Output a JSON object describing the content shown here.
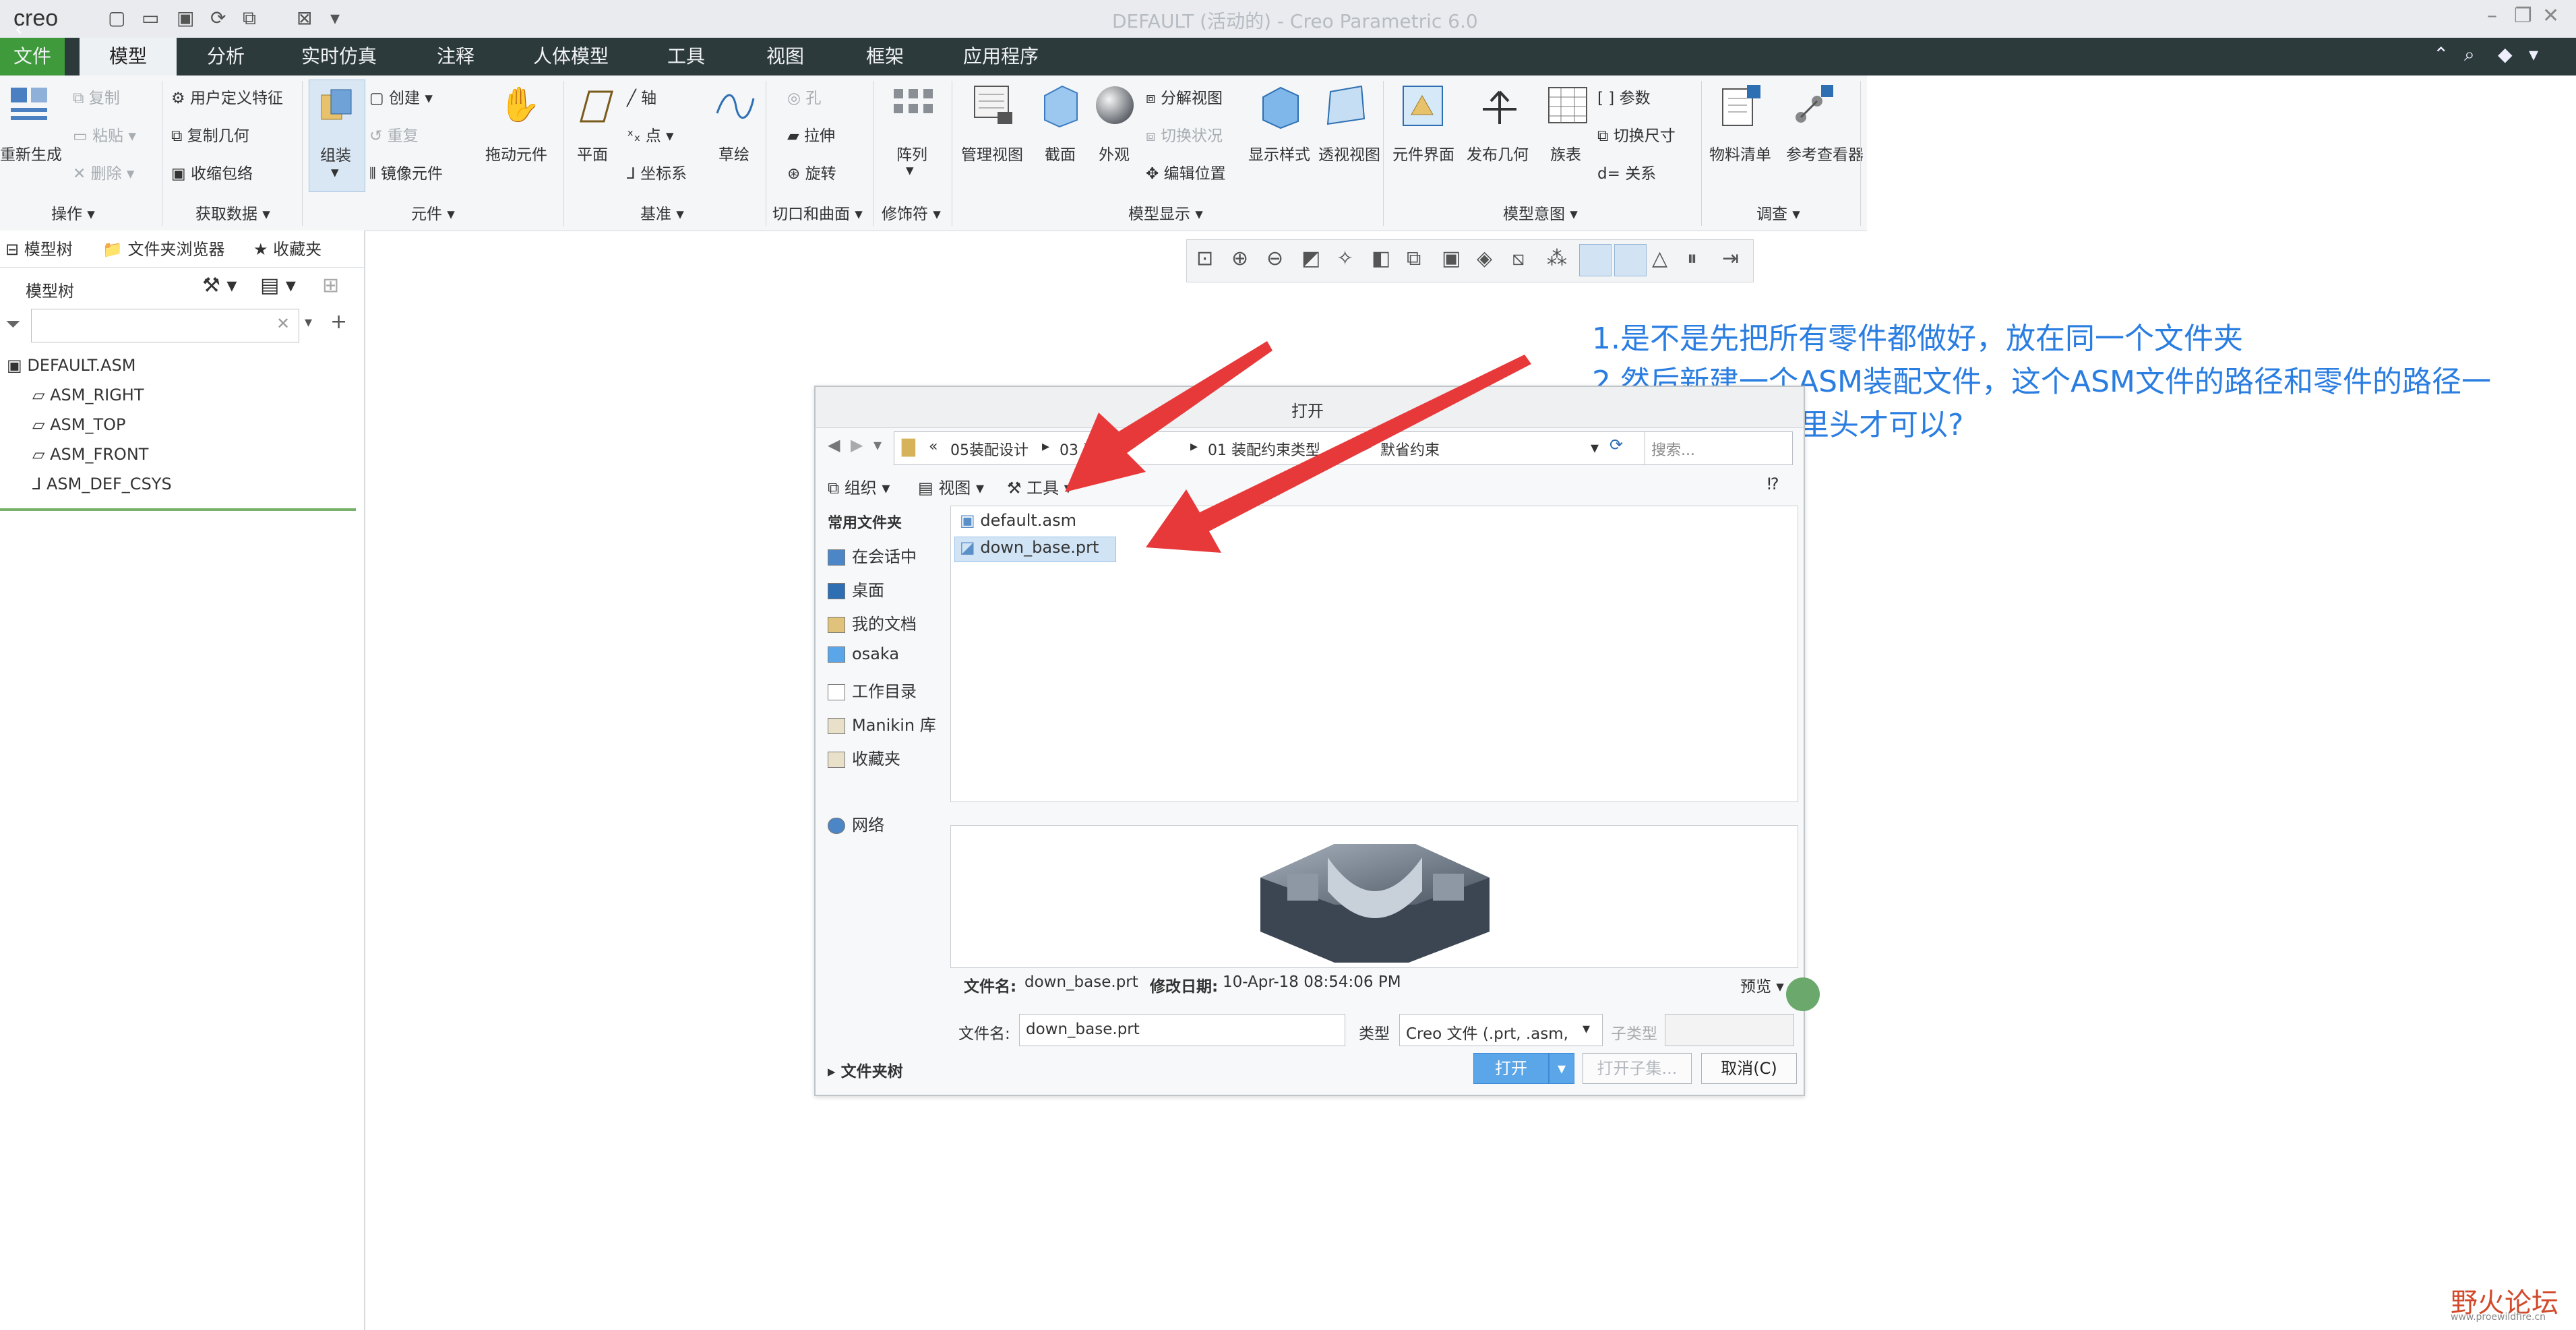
{
  "app": {
    "title": "DEFAULT (活动的) - Creo Parametric 6.0",
    "logo": "creo"
  },
  "ribbon_tabs": [
    "文件",
    "模型",
    "分析",
    "实时仿真",
    "注释",
    "人体模型",
    "工具",
    "视图",
    "框架",
    "应用程序"
  ],
  "ribbon": {
    "regen_label": "重新生成",
    "copy": "复制",
    "paste": "粘贴",
    "delete": "删除",
    "user_feature": "用户定义特征",
    "copy_geometry": "复制几何",
    "shrinkwrap": "收缩包络",
    "assemble": "组装",
    "create": "创建",
    "repeat": "重复",
    "mirror_component": "镜像元件",
    "drag_component": "拖动元件",
    "plane": "平面",
    "axis": "轴",
    "point": "点",
    "csys": "坐标系",
    "sketch": "草绘",
    "hole": "孔",
    "extrude": "拉伸",
    "revolve": "旋转",
    "pattern": "阵列",
    "manage_views": "管理视图",
    "section": "截面",
    "appearance": "外观",
    "explode_view": "分解视图",
    "toggle_status": "切换状况",
    "edit_position": "编辑位置",
    "display_style": "显示样式",
    "perspective_view": "透视视图",
    "component_interface": "元件界面",
    "publish_geometry": "发布几何",
    "family_table": "族表",
    "parameters": "参数",
    "switch_dimensions": "切换尺寸",
    "relations": "关系",
    "bom": "物料清单",
    "reference_viewer": "参考查看器",
    "groups": [
      "操作",
      "获取数据",
      "元件",
      "基准",
      "切口和曲面",
      "修饰符",
      "模型显示",
      "模型意图",
      "调查"
    ]
  },
  "left_panel": {
    "tabs": [
      "模型树",
      "文件夹浏览器",
      "收藏夹"
    ],
    "tree_header": "模型树",
    "tree_items": [
      "DEFAULT.ASM",
      "ASM_RIGHT",
      "ASM_TOP",
      "ASM_FRONT",
      "ASM_DEF_CSYS"
    ]
  },
  "annotation": {
    "line1": "1.是不是先把所有零件都做好，放在同一个文件夹",
    "line2": "2.然后新建一个ASM装配文件，这个ASM文件的路径和零件的路径一",
    "line3": "在同一个文件夹里头才可以?"
  },
  "dialog": {
    "title": "打开",
    "path": [
      "«",
      "05装配设计",
      "03 装",
      "01 装配约束类型",
      "默省约束"
    ],
    "search_placeholder": "搜索...",
    "toolbar": [
      "组织",
      "视图",
      "工具"
    ],
    "sidebar_header": "常用文件夹",
    "sidebar_items": [
      "在会话中",
      "桌面",
      "我的文档",
      "osaka",
      "工作目录",
      "Manikin 库",
      "收藏夹"
    ],
    "network": "网络",
    "files": [
      "default.asm",
      "down_base.prt"
    ],
    "selected_file": "down_base.prt",
    "info_label_name": "文件名:",
    "info_name": "down_base.prt",
    "info_label_date": "修改日期:",
    "info_date": "10-Apr-18 08:54:06 PM",
    "preview_label": "预览",
    "filename_label": "文件名:",
    "filename_value": "down_base.prt",
    "type_label": "类型",
    "type_value": "Creo 文件 (.prt, .asm,",
    "subtype_label": "子类型",
    "folder_tree_label": "文件夹树",
    "open_button": "打开",
    "open_subtype_button": "打开子集...",
    "cancel_button": "取消(C)"
  },
  "watermark": {
    "text": "野火论坛",
    "url": "www.proewildfire.cn"
  },
  "colors": {
    "tab_bar": "#2d3a3c",
    "file_tab": "#3f9a3c",
    "annotation": "#2a7de1",
    "arrow": "#e8393a",
    "primary_button": "#5aa6e8"
  }
}
